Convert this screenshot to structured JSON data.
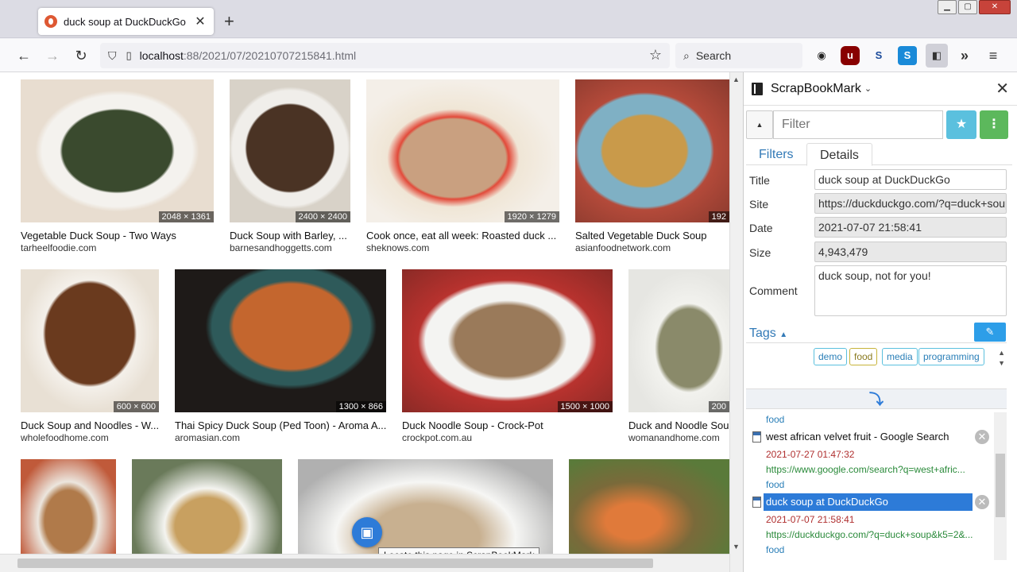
{
  "tab": {
    "title": "duck soup at DuckDuckGo",
    "close": "✕"
  },
  "toolbar": {
    "back": "←",
    "forward": "→",
    "reload": "↻",
    "url_host": "localhost",
    "url_rest": ":88/2021/07/20210707215841.html",
    "search_placeholder": "Search"
  },
  "results": [
    {
      "title": "Vegetable Duck Soup - Two Ways",
      "domain": "tarheelfoodie.com",
      "dims": "2048 × 1361",
      "color": "#3a4a2e"
    },
    {
      "title": "Duck Soup with Barley, ...",
      "domain": "barnesandhoggetts.com",
      "dims": "2400 × 2400",
      "color": "#4a3324"
    },
    {
      "title": "Cook once, eat all week: Roasted duck ...",
      "domain": "sheknows.com",
      "dims": "1920 × 1279",
      "color": "#c9a080"
    },
    {
      "title": "Salted Vegetable Duck Soup",
      "domain": "asianfoodnetwork.com",
      "dims": "192",
      "color": "#7fb0c4"
    },
    {
      "title": "Duck Soup and Noodles - W...",
      "domain": "wholefoodhome.com",
      "dims": "600 × 600",
      "color": "#6a3a1e"
    },
    {
      "title": "Thai Spicy Duck Soup (Ped Toon) - Aroma A...",
      "domain": "aromasian.com",
      "dims": "1300 × 866",
      "color": "#2e5a5a"
    },
    {
      "title": "Duck Noodle Soup - Crock-Pot",
      "domain": "crockpot.com.au",
      "dims": "1500 × 1000",
      "color": "#9a7a5a"
    },
    {
      "title": "Duck and Noodle Sou",
      "domain": "womanandhome.com",
      "dims": "200",
      "color": "#8a8a6a"
    },
    {
      "title": "",
      "domain": "",
      "dims": "",
      "color": "#b07a4a"
    },
    {
      "title": "",
      "domain": "",
      "dims": "",
      "color": "#6a7a5a"
    },
    {
      "title": "",
      "domain": "",
      "dims": "",
      "color": "#c8b090"
    },
    {
      "title": "",
      "domain": "",
      "dims": "",
      "color": "#7a6a3a"
    }
  ],
  "tooltip": "Locate this page in ScrapBookMark",
  "sidebar": {
    "name": "ScrapBookMark",
    "filter_placeholder": "Filter",
    "tabs": {
      "filters": "Filters",
      "details": "Details"
    },
    "details": {
      "title_label": "Title",
      "title_value": "duck soup at DuckDuckGo",
      "site_label": "Site",
      "site_value": "https://duckduckgo.com/?q=duck+soup",
      "date_label": "Date",
      "date_value": "2021-07-07 21:58:41",
      "size_label": "Size",
      "size_value": "4,943,479",
      "comment_label": "Comment",
      "comment_value": "duck soup, not for you!"
    },
    "tags_label": "Tags",
    "tags": [
      "demo",
      "food",
      "media",
      "programming"
    ],
    "items": [
      {
        "tag": "food"
      },
      {
        "title": "west african velvet fruit - Google Search",
        "date": "2021-07-27 01:47:32",
        "url": "https://www.google.com/search?q=west+afric...",
        "tag": "food"
      },
      {
        "title": "duck soup at DuckDuckGo",
        "date": "2021-07-07 21:58:41",
        "url": "https://duckduckgo.com/?q=duck+soup&k5=2&...",
        "tag": "food"
      }
    ]
  }
}
